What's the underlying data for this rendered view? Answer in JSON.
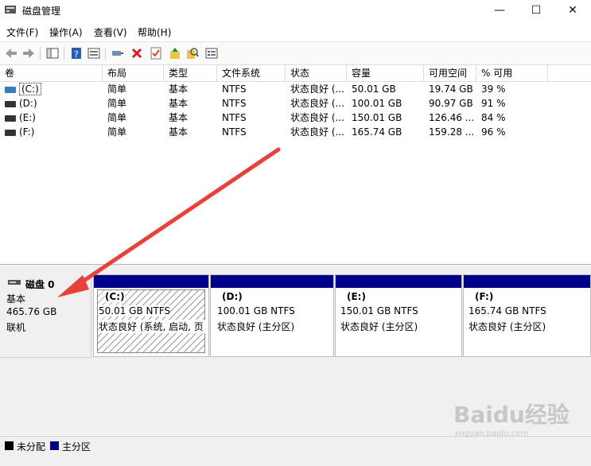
{
  "window": {
    "title": "磁盘管理",
    "minimize": "—",
    "maximize": "☐",
    "close": "✕"
  },
  "menu": [
    "文件(F)",
    "操作(A)",
    "查看(V)",
    "帮助(H)"
  ],
  "toolbar_icons": [
    "back-icon",
    "forward-icon",
    "console-tree-icon",
    "help-icon",
    "properties-icon",
    "connect-icon",
    "delete-icon",
    "check-icon",
    "up-icon",
    "search-icon",
    "list-icon"
  ],
  "table": {
    "headers": [
      "卷",
      "布局",
      "类型",
      "文件系统",
      "状态",
      "容量",
      "可用空间",
      "% 可用"
    ],
    "rows": [
      [
        "(C:)",
        "简单",
        "基本",
        "NTFS",
        "状态良好 (...",
        "50.01 GB",
        "19.74 GB",
        "39 %"
      ],
      [
        "(D:)",
        "简单",
        "基本",
        "NTFS",
        "状态良好 (...",
        "100.01 GB",
        "90.97 GB",
        "91 %"
      ],
      [
        "(E:)",
        "简单",
        "基本",
        "NTFS",
        "状态良好 (...",
        "150.01 GB",
        "126.46 ...",
        "84 %"
      ],
      [
        "(F:)",
        "简单",
        "基本",
        "NTFS",
        "状态良好 (...",
        "165.74 GB",
        "159.28 ...",
        "96 %"
      ]
    ]
  },
  "disk": {
    "name": "磁盘 0",
    "type": "基本",
    "size": "465.76 GB",
    "status": "联机"
  },
  "partitions": [
    {
      "label": "(C:)",
      "size": "50.01 GB NTFS",
      "status": "状态良好 (系统, 启动, 页"
    },
    {
      "label": "(D:)",
      "size": "100.01 GB NTFS",
      "status": "状态良好 (主分区)"
    },
    {
      "label": "(E:)",
      "size": "150.01 GB NTFS",
      "status": "状态良好 (主分区)"
    },
    {
      "label": "(F:)",
      "size": "165.74 GB NTFS",
      "status": "状态良好 (主分区)"
    }
  ],
  "legend": {
    "unallocated": "未分配",
    "primary": "主分区"
  },
  "colors": {
    "primary_partition": "#00008b",
    "unallocated": "#000000",
    "arrow": "#e8403a"
  },
  "watermark": {
    "brand": "Baidu经验",
    "url": "jingyan.baidu.com"
  }
}
